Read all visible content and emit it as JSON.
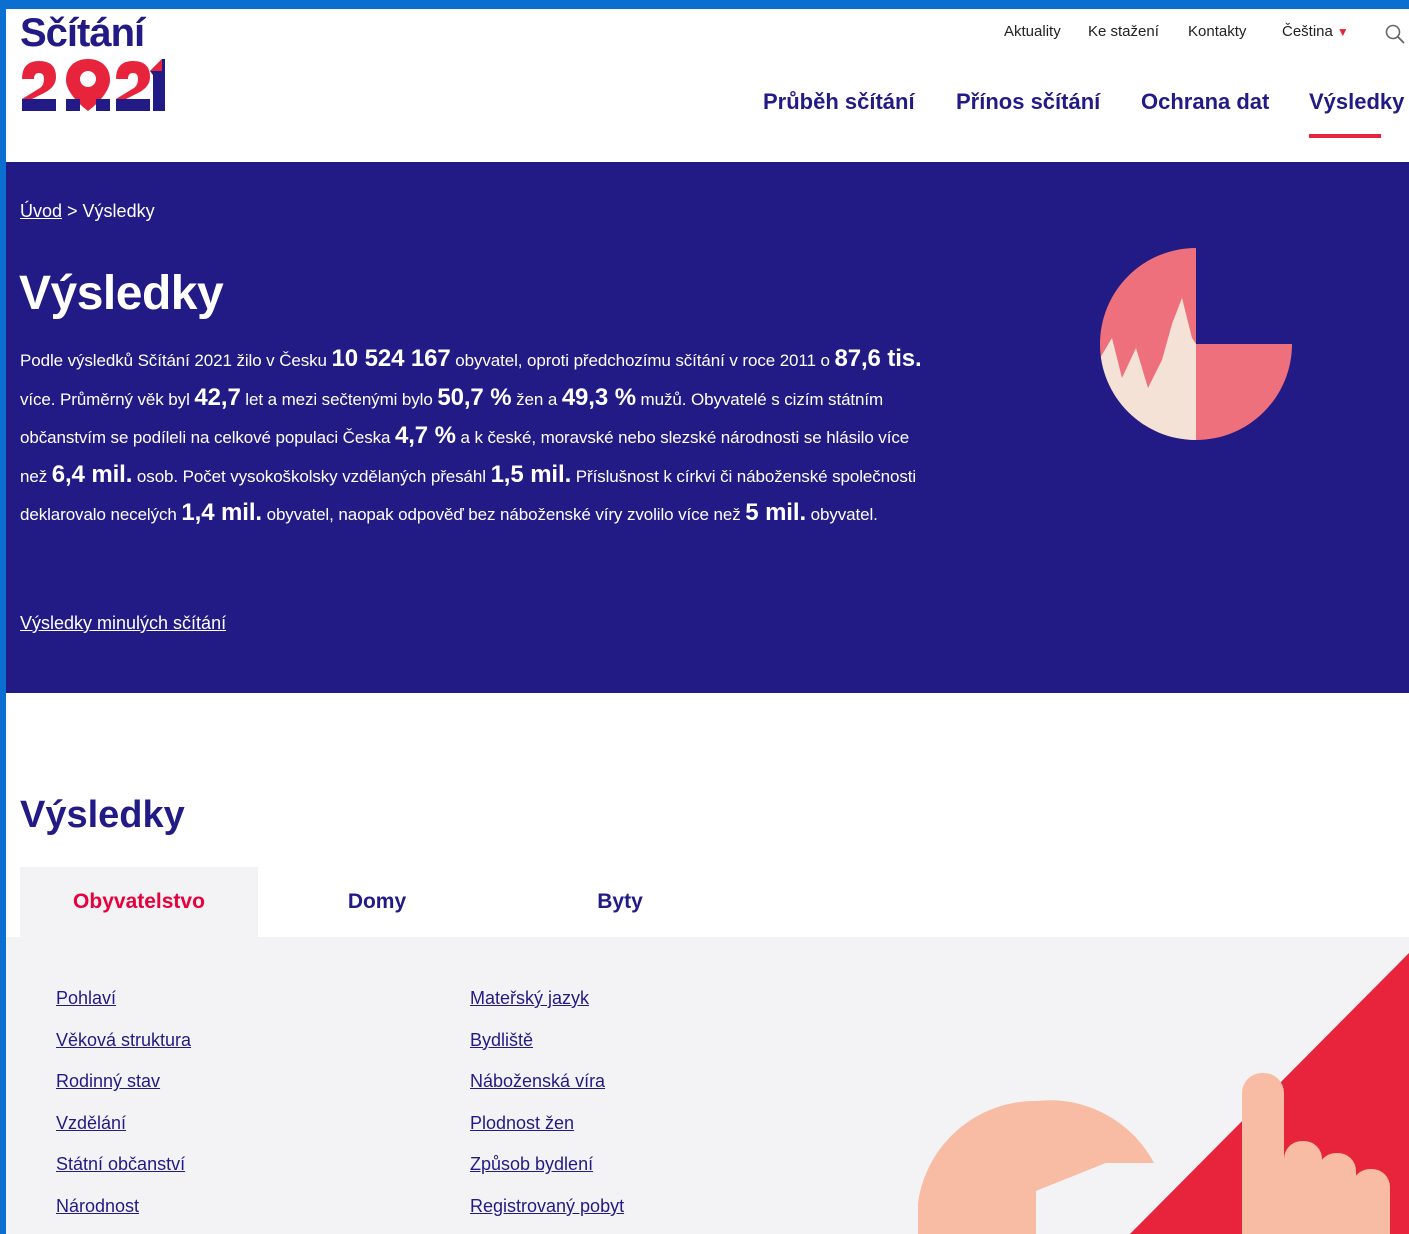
{
  "colors": {
    "brand_navy": "#231b85",
    "accent_red": "#e8243c",
    "background_blue": "#0a6fd0",
    "panel_gray": "#f3f3f5"
  },
  "logo": {
    "word": "Sčítání",
    "year": "2021"
  },
  "util_nav": {
    "links": [
      "Aktuality",
      "Ke stažení",
      "Kontakty"
    ],
    "language": "Čeština",
    "search_icon": "search-icon"
  },
  "main_nav": [
    "Průběh sčítání",
    "Přínos sčítání",
    "Ochrana dat",
    "Výsledky"
  ],
  "hero": {
    "breadcrumb_home": "Úvod",
    "breadcrumb_sep": " > ",
    "breadcrumb_current": "Výsledky",
    "title": "Výsledky",
    "text": {
      "t1": "Podle výsledků Sčítání 2021 žilo v Česku ",
      "n1": "10 524 167",
      "t2": "  obyvatel, oproti předchozímu sčítání v roce 2011 o  ",
      "n2": "87,6 tis.",
      "t3": "  více. Průměrný věk byl  ",
      "n3": "42,7",
      "t4": "  let a mezi sečtenými bylo  ",
      "n4": "50,7 %",
      "t5": "  žen a  ",
      "n5": "49,3 %",
      "t6": " mužů. Obyvatelé s cizím státním občanstvím se podíleli na celkové populaci Česka  ",
      "n6": "4,7 %",
      "t7": "  a k české, moravské nebo slezské národnosti se hlásilo více než  ",
      "n7": "6,4 mil.",
      "t8": "  osob. Počet vysokoškolsky vzdělaných přesáhl ",
      "n8": "1,5 mil.",
      "t9": " Příslušnost k církvi či náboženské společnosti deklarovalo necelých ",
      "n9": "1,4 mil.",
      "t10": " obyvatel, naopak odpověď bez náboženské víry zvolilo více než ",
      "n10": "5 mil.",
      "t11": " obyvatel."
    },
    "past_results_link": "Výsledky minulých sčítání"
  },
  "results": {
    "title": "Výsledky",
    "tabs": [
      "Obyvatelstvo",
      "Domy",
      "Byty"
    ],
    "active_tab": "Obyvatelstvo",
    "links_col1": [
      "Pohlaví",
      "Věková struktura",
      "Rodinný stav",
      "Vzdělání",
      "Státní občanství",
      "Národnost"
    ],
    "links_col2": [
      "Mateřský jazyk",
      "Bydliště",
      "Náboženská víra",
      "Plodnost žen",
      "Způsob bydlení",
      "Registrovaný pobyt"
    ]
  }
}
